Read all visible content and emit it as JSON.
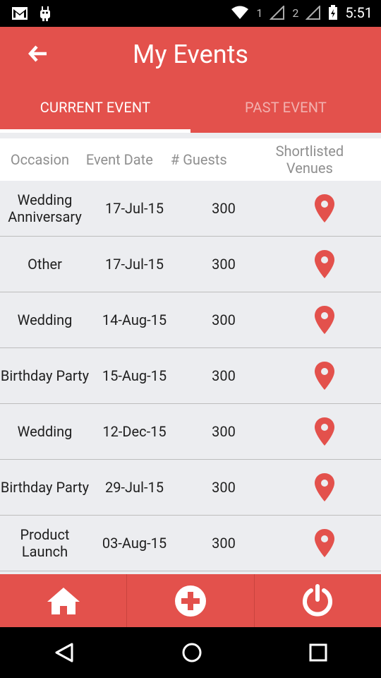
{
  "status_bar": {
    "time": "5:51",
    "sim1": "1",
    "sim2": "2"
  },
  "app_bar": {
    "title": "My Events"
  },
  "tabs": [
    {
      "label": "CURRENT EVENT"
    },
    {
      "label": "PAST EVENT"
    }
  ],
  "table": {
    "headers": [
      "Occasion",
      "Event Date",
      "# Guests",
      "Shortlisted Venues"
    ],
    "rows": [
      {
        "occasion": "Wedding Anniversary",
        "date": "17-Jul-15",
        "guests": "300"
      },
      {
        "occasion": "Other",
        "date": "17-Jul-15",
        "guests": "300"
      },
      {
        "occasion": "Wedding",
        "date": "14-Aug-15",
        "guests": "300"
      },
      {
        "occasion": "Birthday Party",
        "date": "15-Aug-15",
        "guests": "300"
      },
      {
        "occasion": "Wedding",
        "date": "12-Dec-15",
        "guests": "300"
      },
      {
        "occasion": "Birthday Party",
        "date": "29-Jul-15",
        "guests": "300"
      },
      {
        "occasion": "Product Launch",
        "date": "03-Aug-15",
        "guests": "300"
      }
    ]
  },
  "bottom_nav": [
    {
      "icon": "home-icon"
    },
    {
      "icon": "add-circle-icon"
    },
    {
      "icon": "power-icon"
    }
  ],
  "colors": {
    "accent": "#e3514c",
    "pin": "#e3514c"
  }
}
